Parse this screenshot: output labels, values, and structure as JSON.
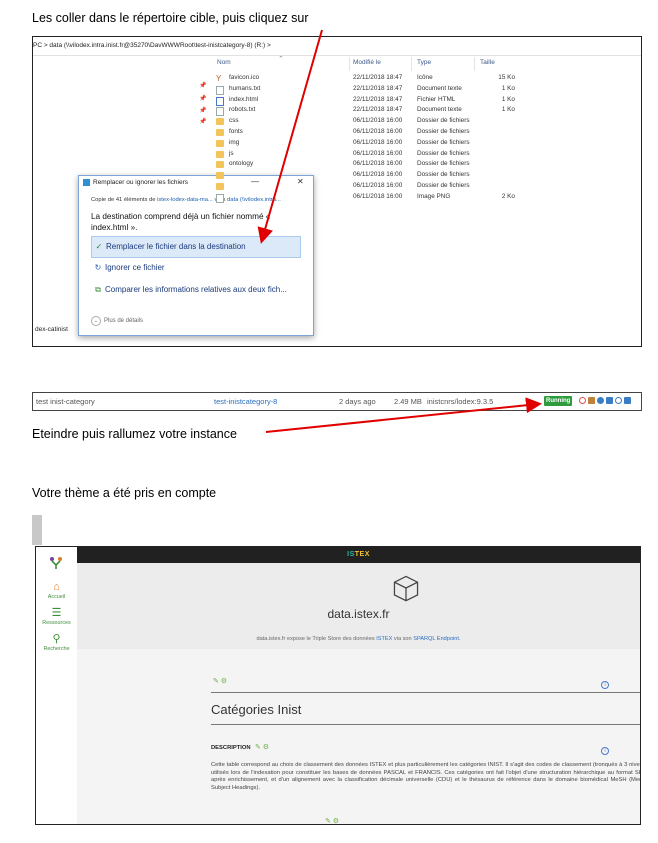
{
  "intro": {
    "step1": "Les coller dans le répertoire cible, puis cliquez sur",
    "step2": "Eteindre puis rallumez votre instance",
    "step3": "Votre thème a été pris en compte"
  },
  "explorer": {
    "address": "PC  >  data (\\\\vilodex.intra.inist.fr@35270\\DavWWWRoot\\test-inistcategory-8) (R:)  >",
    "columns": {
      "name": "Nom",
      "modified": "Modifié le",
      "type": "Type",
      "size": "Taille"
    },
    "files": [
      {
        "name": "favicon.ico",
        "modified": "22/11/2018 18:47",
        "type": "Icône",
        "size": "15 Ko",
        "icon": "fav"
      },
      {
        "name": "humans.txt",
        "modified": "22/11/2018 18:47",
        "type": "Document texte",
        "size": "1 Ko",
        "icon": "file"
      },
      {
        "name": "index.html",
        "modified": "22/11/2018 18:47",
        "type": "Fichier HTML",
        "size": "1 Ko",
        "icon": "html"
      },
      {
        "name": "robots.txt",
        "modified": "22/11/2018 18:47",
        "type": "Document texte",
        "size": "1 Ko",
        "icon": "file"
      },
      {
        "name": "css",
        "modified": "06/11/2018 16:00",
        "type": "Dossier de fichiers",
        "size": "",
        "icon": "folder"
      },
      {
        "name": "fonts",
        "modified": "06/11/2018 16:00",
        "type": "Dossier de fichiers",
        "size": "",
        "icon": "folder"
      },
      {
        "name": "img",
        "modified": "06/11/2018 16:00",
        "type": "Dossier de fichiers",
        "size": "",
        "icon": "folder"
      },
      {
        "name": "js",
        "modified": "06/11/2018 16:00",
        "type": "Dossier de fichiers",
        "size": "",
        "icon": "folder"
      },
      {
        "name": "ontology",
        "modified": "06/11/2018 16:00",
        "type": "Dossier de fichiers",
        "size": "",
        "icon": "folder"
      },
      {
        "name": "",
        "modified": "06/11/2018 16:00",
        "type": "Dossier de fichiers",
        "size": "",
        "icon": "folder"
      },
      {
        "name": "",
        "modified": "06/11/2018 16:00",
        "type": "Dossier de fichiers",
        "size": "",
        "icon": "folder"
      },
      {
        "name": "",
        "modified": "06/11/2018 16:00",
        "type": "Image PNG",
        "size": "2 Ko",
        "icon": "file"
      }
    ],
    "left_label": "dex-catinist"
  },
  "dialog": {
    "title": "Remplacer ou ignorer les fichiers",
    "minimize": "—",
    "close": "✕",
    "copy_prefix": "Copie de 41 éléments de ",
    "copy_source": "istex-lodex-data-ma...",
    "copy_mid": " vers ",
    "copy_dest": "data (\\\\vilodex.intra...",
    "destination_text": "La destination comprend déjà un fichier nommé « index.html ».",
    "options": [
      {
        "icon": "✓",
        "label": "Remplacer le fichier dans la destination"
      },
      {
        "icon": "↻",
        "label": "Ignorer ce fichier"
      },
      {
        "icon": "⧉",
        "label": "Comparer les informations relatives aux deux fich..."
      }
    ],
    "more": "Plus de détails"
  },
  "instance": {
    "name": "test inist-category",
    "link": "test-inistcategory-8",
    "age": "2 days ago",
    "size": "2.49 MB",
    "image": "inistcnrs/lodex:9.3.5",
    "status": "Running",
    "icon_colors": [
      "#d9534f",
      "#c0813a",
      "#3b7dc4",
      "#3b7dc4",
      "#3b7dc4",
      "#3b7dc4"
    ]
  },
  "site": {
    "brand_prefix": "IS",
    "brand_suffix": "TEX",
    "sidebar": [
      {
        "icon": "⌂",
        "label": "Accueil"
      },
      {
        "icon": "☰",
        "label": "Ressources"
      },
      {
        "icon": "⚲",
        "label": "Recherche"
      }
    ],
    "site_name": "data.istex.fr",
    "tagline_prefix": "data.istex.fr expose le Triple Store des données ",
    "tagline_istex": "ISTEX",
    "tagline_mid": " via son ",
    "tagline_link": "SPARQL Endpoint",
    "tagline_end": ".",
    "page_title": "Catégories Inist",
    "section_label": "DESCRIPTION",
    "description": "Cette table correspond au choix de classement des données ISTEX et plus particulièrement les catégories INIST. Il s'agit des codes de classement (tronqués à 3 niveaux) utilisés lors de l'indexation pour constituer les bases de données PASCAL et FRANCIS. Ces catégories ont fait l'objet d'une structuration hiérarchique au format SKOS après enrichissement, et d'un alignement avec la classification décimale universelle (CDU) et le thésaurus de référence dans le domaine biomédical MeSH (Medical Subject Headings)."
  }
}
